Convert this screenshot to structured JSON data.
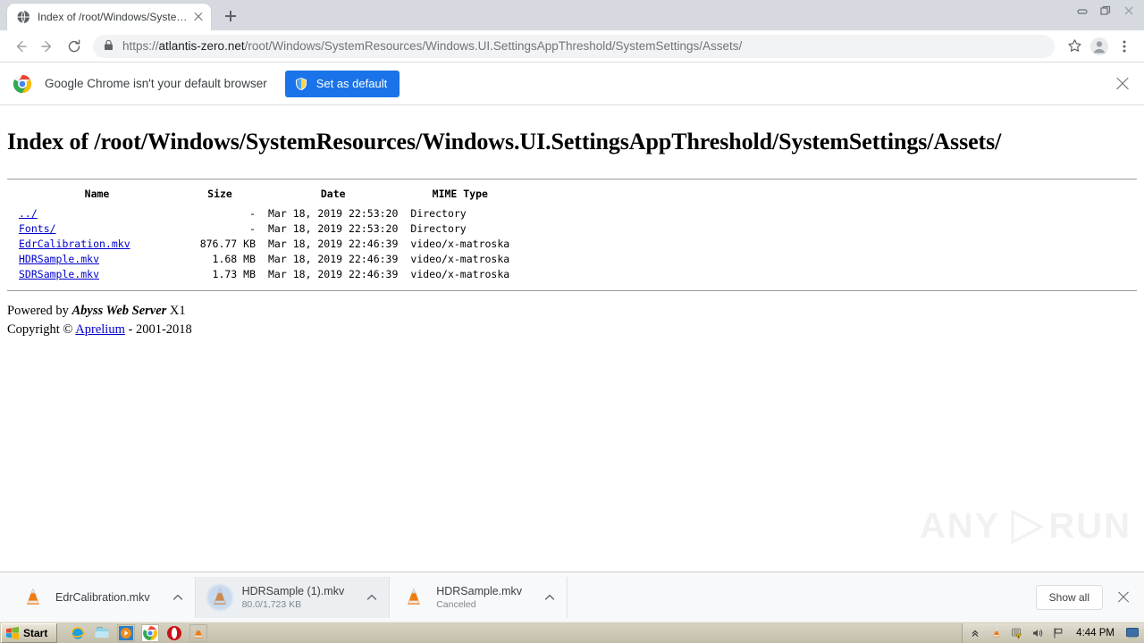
{
  "window": {
    "controls": [
      {
        "name": "minimize-button",
        "glyph": "minimize"
      },
      {
        "name": "restore-button",
        "glyph": "restore"
      },
      {
        "name": "close-button",
        "glyph": "close"
      }
    ]
  },
  "tabstrip": {
    "tab_title": "Index of /root/Windows/SystemRes",
    "favicon": "globe-icon",
    "close_icon": "close-icon",
    "newtab_icon": "plus-icon"
  },
  "toolbar": {
    "back_icon": "arrow-left-icon",
    "forward_icon": "arrow-right-icon",
    "reload_icon": "reload-icon",
    "lock_icon": "lock-icon",
    "url_scheme": "https://",
    "url_host": "atlantis-zero.net",
    "url_path": "/root/Windows/SystemResources/Windows.UI.SettingsAppThreshold/SystemSettings/Assets/",
    "bookmark_icon": "star-icon",
    "profile_icon": "account-avatar-icon",
    "menu_icon": "three-dot-menu-icon"
  },
  "infobar": {
    "chrome_icon": "chrome-logo-icon",
    "message": "Google Chrome isn't your default browser",
    "button_label": "Set as default",
    "button_icon": "shield-defender-icon",
    "button_color": "#1a73e8",
    "close_icon": "close-icon"
  },
  "page": {
    "heading": "Index of /root/Windows/SystemResources/Windows.UI.SettingsAppThreshold/SystemSettings/Assets/",
    "table": {
      "headers": [
        "Name",
        "Size",
        "Date",
        "MIME Type"
      ],
      "rows": [
        {
          "name": "../",
          "size": "-",
          "date": "Mar 18, 2019 22:53:20",
          "mime": "Directory"
        },
        {
          "name": "Fonts/",
          "size": "-",
          "date": "Mar 18, 2019 22:53:20",
          "mime": "Directory"
        },
        {
          "name": "EdrCalibration.mkv",
          "size": "876.77 KB",
          "date": "Mar 18, 2019 22:46:39",
          "mime": "video/x-matroska"
        },
        {
          "name": "HDRSample.mkv",
          "size": "1.68 MB",
          "date": "Mar 18, 2019 22:46:39",
          "mime": "video/x-matroska"
        },
        {
          "name": "SDRSample.mkv",
          "size": "1.73 MB",
          "date": "Mar 18, 2019 22:46:39",
          "mime": "video/x-matroska"
        }
      ]
    },
    "footer": {
      "powered_prefix": "Powered by ",
      "server_name": "Abyss Web Server",
      "server_version": " X1",
      "copyright_prefix": "Copyright © ",
      "vendor": "Aprelium",
      "copyright_suffix": " - 2001-2018"
    }
  },
  "watermark": {
    "left_text": "ANY",
    "right_text": "RUN",
    "play_icon": "play-triangle-icon"
  },
  "download_shelf": {
    "items": [
      {
        "name": "EdrCalibration.mkv",
        "status": "",
        "icon": "vlc-cone-icon",
        "active": false,
        "caret": "chevron-up-icon"
      },
      {
        "name": "HDRSample (1).mkv",
        "status": "80.0/1,723 KB",
        "icon": "vlc-cone-icon",
        "active": true,
        "caret": "chevron-up-icon"
      },
      {
        "name": "HDRSample.mkv",
        "status": "Canceled",
        "icon": "vlc-cone-icon",
        "active": false,
        "caret": "chevron-up-icon"
      }
    ],
    "show_all_label": "Show all",
    "close_icon": "close-icon"
  },
  "taskbar": {
    "start_label": "Start",
    "quicklaunch": [
      {
        "name": "internet-explorer-icon"
      },
      {
        "name": "windows-explorer-icon"
      },
      {
        "name": "media-player-icon"
      },
      {
        "name": "chrome-icon"
      },
      {
        "name": "opera-icon"
      },
      {
        "name": "vlc-icon"
      }
    ],
    "tray": [
      {
        "name": "show-hidden-icons-icon"
      },
      {
        "name": "vlc-tray-icon"
      },
      {
        "name": "security-alert-icon"
      },
      {
        "name": "volume-icon"
      },
      {
        "name": "action-flag-icon"
      }
    ],
    "clock": "4:44 PM",
    "show_desktop_icon": "show-desktop-icon"
  }
}
